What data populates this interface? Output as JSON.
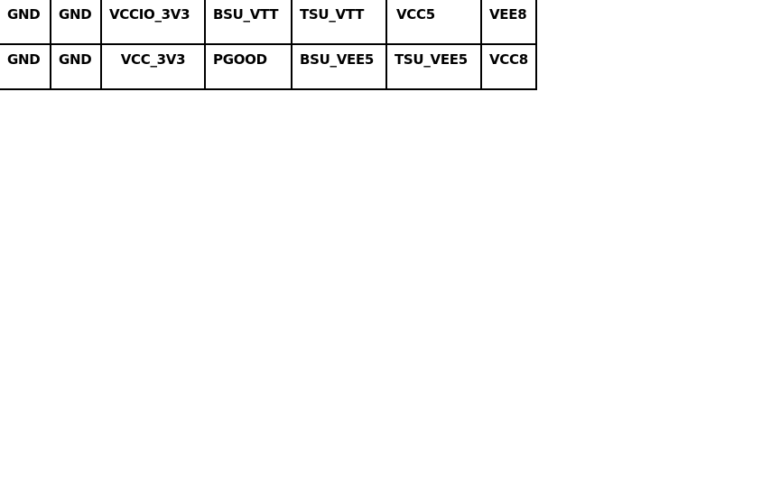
{
  "pin_table": {
    "rows": [
      [
        "GND",
        "GND",
        "VCCIO_3V3",
        "BSU_VTT",
        "TSU_VTT",
        "VCC5",
        "VEE8"
      ],
      [
        "GND",
        "GND",
        "VCC_3V3",
        "PGOOD",
        "BSU_VEE5",
        "TSU_VEE5",
        "VCC8"
      ]
    ]
  }
}
